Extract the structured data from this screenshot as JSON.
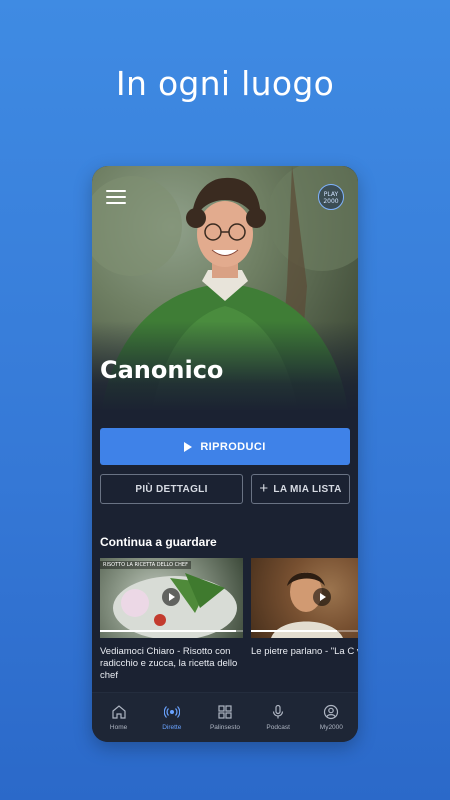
{
  "headline": "In ogni luogo",
  "app": {
    "logo_text_line1": "PLAY",
    "logo_text_line2": "2000"
  },
  "hero": {
    "title": "Canonico"
  },
  "actions": {
    "play_label": "RIPRODUCI",
    "details_label": "PIÙ DETTAGLI",
    "mylist_label": "LA MIA LISTA"
  },
  "continue_watching": {
    "title": "Continua a guardare",
    "items": [
      {
        "title": "Vediamoci Chiaro  - Risotto con radicchio e zucca, la ricetta dello chef",
        "banner": "RISOTTO LA RICETTA DELLO CHEF",
        "progress": 0.95
      },
      {
        "title": "Le pietre parlano - \"La C viene alla luce\"",
        "banner": "",
        "progress": 0.6
      }
    ]
  },
  "tabs": [
    {
      "label": "Home",
      "icon": "home-icon",
      "active": false
    },
    {
      "label": "Dirette",
      "icon": "live-icon",
      "active": true
    },
    {
      "label": "Palinsesto",
      "icon": "grid-icon",
      "active": false
    },
    {
      "label": "Podcast",
      "icon": "microphone-icon",
      "active": false
    },
    {
      "label": "My2000",
      "icon": "user-icon",
      "active": false
    }
  ],
  "colors": {
    "background": "#3f8be3",
    "phone_bg": "#1b2232",
    "accent": "#3f82e8",
    "active_tab": "#6aa3ff"
  }
}
